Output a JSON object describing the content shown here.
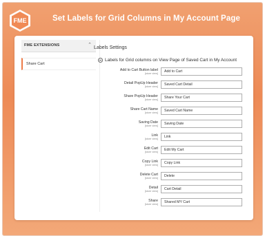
{
  "banner": {
    "title": "Set Labels for Grid Columns in My Account Page",
    "logo_icon": "fme-logo-icon"
  },
  "sidebar": {
    "header_label": "FME EXTENSIONS",
    "header_chevron": "chevron-up-icon",
    "items": [
      {
        "label": "Share Cart"
      }
    ]
  },
  "main": {
    "title": "Labels Settings",
    "section_title": "Labels for Grid columns on View Page of Saved Cart in My Account",
    "rows": [
      {
        "label": "Add to Cart Button label",
        "scope": "[store view]",
        "value": "Add to Cart"
      },
      {
        "label": "Detail PopUp Header",
        "scope": "[store view]",
        "value": "Saved Cart Detail"
      },
      {
        "label": "Share PopUp Header",
        "scope": "[store view]",
        "value": "Share Your Cart"
      },
      {
        "label": "Share Cart Name",
        "scope": "[store view]",
        "value": "Saved Cart Name"
      },
      {
        "label": "Saving Date",
        "scope": "[store view]",
        "value": "Saving Date"
      },
      {
        "label": "Link",
        "scope": "[store view]",
        "value": "Link"
      },
      {
        "label": "Edit Cart",
        "scope": "[store view]",
        "value": "Edit My Cart"
      },
      {
        "label": "Copy Link",
        "scope": "[store view]",
        "value": "Copy Link"
      },
      {
        "label": "Delete Cart",
        "scope": "[store view]",
        "value": "Delete"
      },
      {
        "label": "Detail",
        "scope": "[store view]",
        "value": "Cart Detail"
      },
      {
        "label": "Share",
        "scope": "[store view]",
        "value": "Shared MY Cart"
      }
    ]
  },
  "colors": {
    "accent": "#ed7a47",
    "banner_text": "#ffffff"
  }
}
